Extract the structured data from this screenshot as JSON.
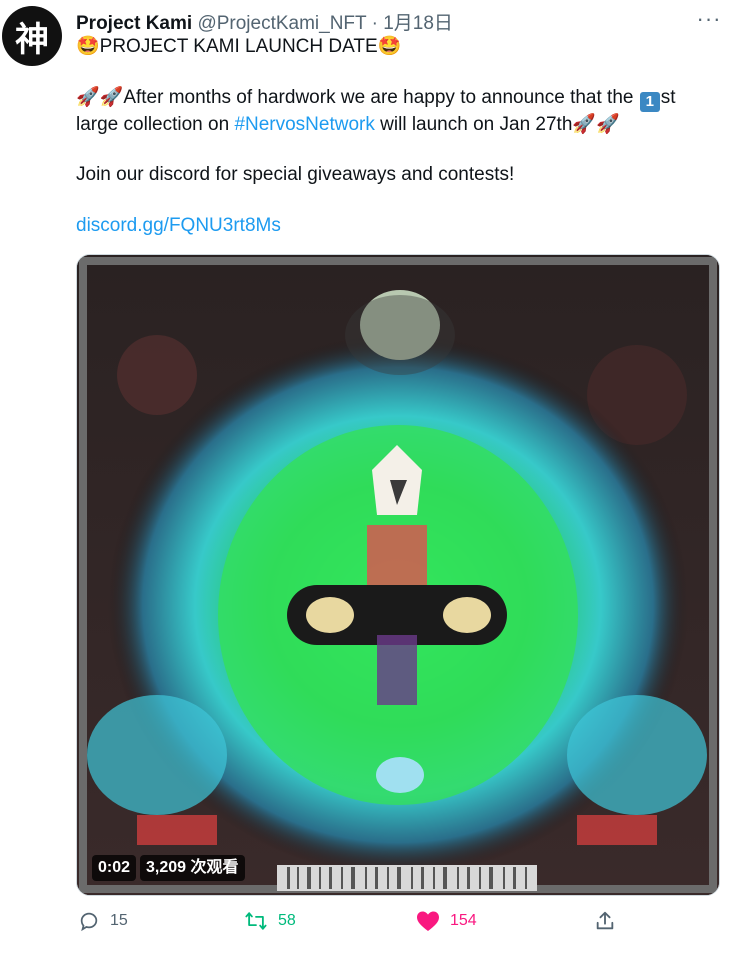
{
  "tweet": {
    "avatar_char": "神",
    "author_name": "Project Kami",
    "author_handle": "@ProjectKami_NFT",
    "separator": "·",
    "date": "1月18日",
    "more_label": "···",
    "line1": "🤩PROJECT KAMI LAUNCH DATE🤩",
    "line2_a": "🚀🚀After months of hardwork we are happy to announce that the ",
    "keycap": "1",
    "line2_b": "st",
    "line2_c": "large collection on ",
    "hashtag": "#NervosNetwork",
    "line2_d": " will launch on Jan 27th🚀🚀",
    "line3": "Join our discord for special giveaways and contests!",
    "link": "discord.gg/FQNU3rt8Ms"
  },
  "video": {
    "time": "0:02",
    "views": "3,209 次观看"
  },
  "actions": {
    "reply_count": "15",
    "retweet_count": "58",
    "like_count": "154"
  },
  "colors": {
    "link": "#1d9bf0",
    "retweet": "#00ba7c",
    "like": "#f91880",
    "muted": "#536471"
  }
}
